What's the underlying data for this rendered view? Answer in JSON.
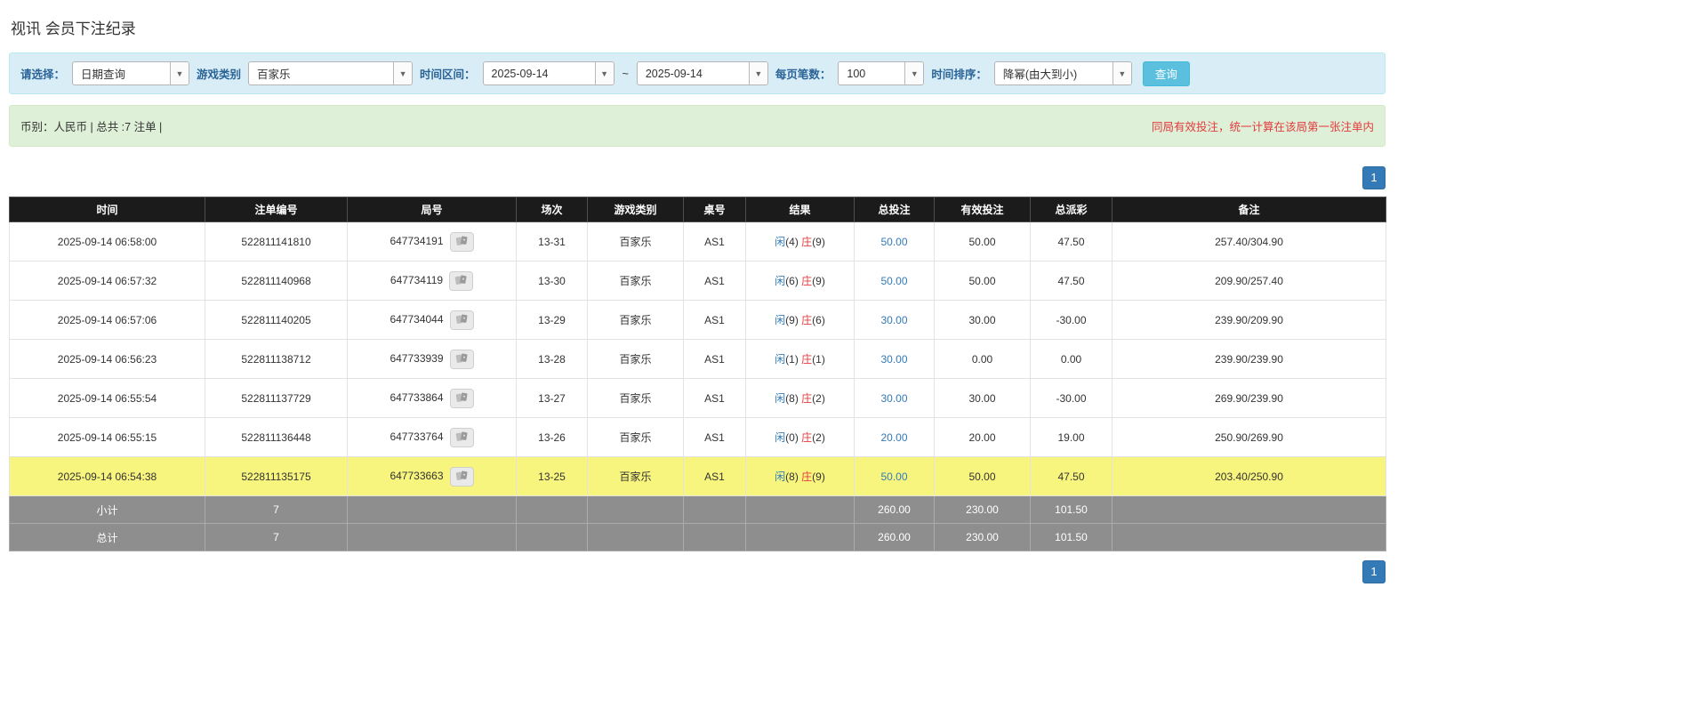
{
  "colors": {
    "filter-bg": "#d9edf7",
    "summary-bg": "#dff0d8",
    "label-blue": "#2a6496",
    "button-cyan": "#5bc0de",
    "link-blue": "#337ab7",
    "pager-blue": "#337ab7",
    "player-blue": "#337ab7",
    "banker-red": "#e4393c",
    "negative-red": "#e4393c",
    "notice-red": "#e4393c",
    "header-bg": "#1b1b1b",
    "footer-bg": "#8e8e8e",
    "highlight-yellow": "#f8f57f"
  },
  "page": {
    "title": "视讯 会员下注纪录"
  },
  "filters": {
    "query_type": {
      "label": "请选择：",
      "value": "日期查询"
    },
    "game_type": {
      "label": "游戏类别",
      "value": "百家乐"
    },
    "date_range": {
      "label": "时间区间：",
      "from": "2025-09-14",
      "separator": "~",
      "to": "2025-09-14"
    },
    "page_size": {
      "label": "每页笔数：",
      "value": "100"
    },
    "time_sort": {
      "label": "时间排序：",
      "value": "降幂(由大到小)"
    },
    "search_button_label": "查询"
  },
  "summary": {
    "left": "币别：人民币 | 总共 :7 注单 |",
    "right": "同局有效投注，统一计算在该局第一张注单内"
  },
  "pagination": {
    "current_page": "1"
  },
  "table": {
    "headers": [
      "时间",
      "注单编号",
      "局号",
      "场次",
      "游戏类别",
      "桌号",
      "结果",
      "总投注",
      "有效投注",
      "总派彩",
      "备注"
    ],
    "rows": [
      {
        "time": "2025-09-14 06:58:00",
        "bet_id": "522811141810",
        "round": "647734191",
        "session": "13-31",
        "game_type": "百家乐",
        "table_no": "AS1",
        "result": {
          "player_label": "闲",
          "player_score": "(4)",
          "banker_label": "庄",
          "banker_score": "(9)"
        },
        "total_bet": "50.00",
        "valid_bet": "50.00",
        "payout": "47.50",
        "remark": "257.40/304.90",
        "highlighted": false
      },
      {
        "time": "2025-09-14 06:57:32",
        "bet_id": "522811140968",
        "round": "647734119",
        "session": "13-30",
        "game_type": "百家乐",
        "table_no": "AS1",
        "result": {
          "player_label": "闲",
          "player_score": "(6)",
          "banker_label": "庄",
          "banker_score": "(9)"
        },
        "total_bet": "50.00",
        "valid_bet": "50.00",
        "payout": "47.50",
        "remark": "209.90/257.40",
        "highlighted": false
      },
      {
        "time": "2025-09-14 06:57:06",
        "bet_id": "522811140205",
        "round": "647734044",
        "session": "13-29",
        "game_type": "百家乐",
        "table_no": "AS1",
        "result": {
          "player_label": "闲",
          "player_score": "(9)",
          "banker_label": "庄",
          "banker_score": "(6)"
        },
        "total_bet": "30.00",
        "valid_bet": "30.00",
        "payout": "-30.00",
        "remark": "239.90/209.90",
        "highlighted": false
      },
      {
        "time": "2025-09-14 06:56:23",
        "bet_id": "522811138712",
        "round": "647733939",
        "session": "13-28",
        "game_type": "百家乐",
        "table_no": "AS1",
        "result": {
          "player_label": "闲",
          "player_score": "(1)",
          "banker_label": "庄",
          "banker_score": "(1)"
        },
        "total_bet": "30.00",
        "valid_bet": "0.00",
        "payout": "0.00",
        "remark": "239.90/239.90",
        "highlighted": false
      },
      {
        "time": "2025-09-14 06:55:54",
        "bet_id": "522811137729",
        "round": "647733864",
        "session": "13-27",
        "game_type": "百家乐",
        "table_no": "AS1",
        "result": {
          "player_label": "闲",
          "player_score": "(8)",
          "banker_label": "庄",
          "banker_score": "(2)"
        },
        "total_bet": "30.00",
        "valid_bet": "30.00",
        "payout": "-30.00",
        "remark": "269.90/239.90",
        "highlighted": false
      },
      {
        "time": "2025-09-14 06:55:15",
        "bet_id": "522811136448",
        "round": "647733764",
        "session": "13-26",
        "game_type": "百家乐",
        "table_no": "AS1",
        "result": {
          "player_label": "闲",
          "player_score": "(0)",
          "banker_label": "庄",
          "banker_score": "(2)"
        },
        "total_bet": "20.00",
        "valid_bet": "20.00",
        "payout": "19.00",
        "remark": "250.90/269.90",
        "highlighted": false
      },
      {
        "time": "2025-09-14 06:54:38",
        "bet_id": "522811135175",
        "round": "647733663",
        "session": "13-25",
        "game_type": "百家乐",
        "table_no": "AS1",
        "result": {
          "player_label": "闲",
          "player_score": "(8)",
          "banker_label": "庄",
          "banker_score": "(9)"
        },
        "total_bet": "50.00",
        "valid_bet": "50.00",
        "payout": "47.50",
        "remark": "203.40/250.90",
        "highlighted": true
      }
    ],
    "footer_rows": [
      {
        "label": "小计",
        "count": "7",
        "total_bet": "260.00",
        "valid_bet": "230.00",
        "payout": "101.50"
      },
      {
        "label": "总计",
        "count": "7",
        "total_bet": "260.00",
        "valid_bet": "230.00",
        "payout": "101.50"
      }
    ]
  }
}
